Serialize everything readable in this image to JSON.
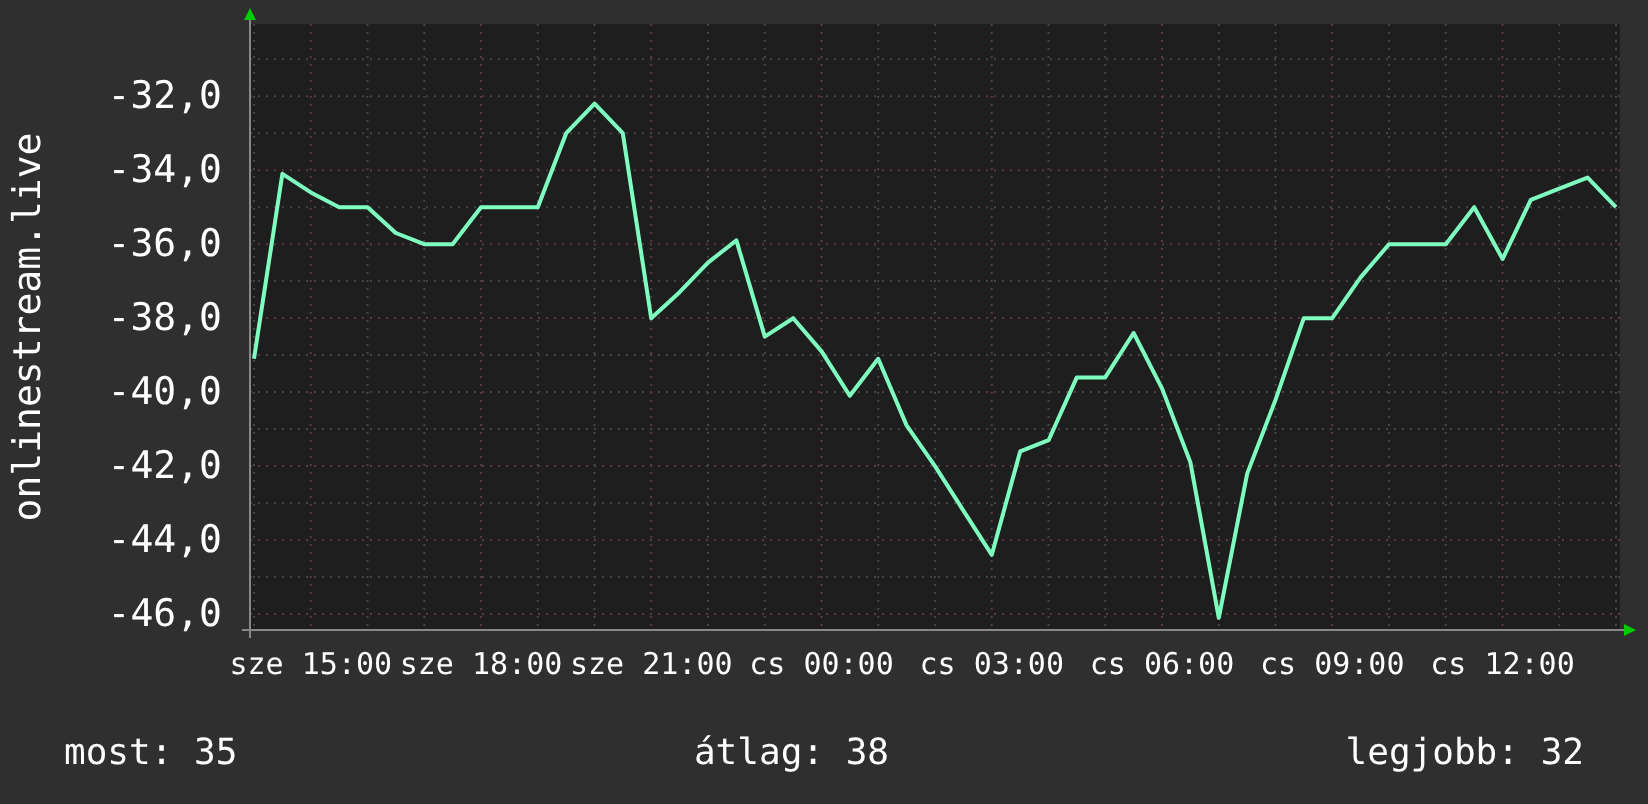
{
  "chart": {
    "chart_data": {
      "type": "line",
      "ylabel": "onlinestream.live",
      "categories": [
        null,
        null,
        "sze 15:00",
        null,
        null,
        null,
        null,
        null,
        "sze 18:00",
        null,
        null,
        null,
        null,
        null,
        "sze 21:00",
        null,
        null,
        null,
        null,
        null,
        "cs 00:00",
        null,
        null,
        null,
        null,
        null,
        "cs 03:00",
        null,
        null,
        null,
        null,
        null,
        "cs 06:00",
        null,
        null,
        null,
        null,
        null,
        "cs 09:00",
        null,
        null,
        null,
        null,
        null,
        "cs 12:00",
        null,
        null,
        null,
        null
      ],
      "series": [
        {
          "color": "#7fffbf",
          "values": [
            -39.1,
            -34.1,
            -34.6,
            -35,
            -35,
            -35.7,
            -36,
            -36,
            -35,
            -35,
            -35,
            -33,
            -32.2,
            -33,
            -38,
            -37.3,
            -36.5,
            -35.9,
            -38.5,
            -38,
            -38.9,
            -40.1,
            -39.1,
            -40.9,
            -42,
            -43.2,
            -44.4,
            -41.6,
            -41.3,
            -39.6,
            -39.6,
            -38.4,
            -39.9,
            -41.9,
            -46.1,
            -42.2,
            -40.2,
            -38,
            -38,
            -36.9,
            -36,
            -36,
            -36,
            -35,
            -36.4,
            -34.8,
            -34.5,
            -34.2,
            -35
          ]
        }
      ],
      "grid": true,
      "ylim": [
        -46.43,
        -30.05
      ],
      "yticks": [
        {
          "value": -32,
          "label": "-32,0"
        },
        {
          "value": -34,
          "label": "-34,0"
        },
        {
          "value": -36,
          "label": "-36,0"
        },
        {
          "value": -38,
          "label": "-38,0"
        },
        {
          "value": -40,
          "label": "-40,0"
        },
        {
          "value": -42,
          "label": "-42,0"
        },
        {
          "value": -44,
          "label": "-44,0"
        },
        {
          "value": -46,
          "label": "-46,0"
        }
      ]
    }
  },
  "legend": [
    "most: 35",
    "átlag: 38",
    "legjobb: 32"
  ]
}
